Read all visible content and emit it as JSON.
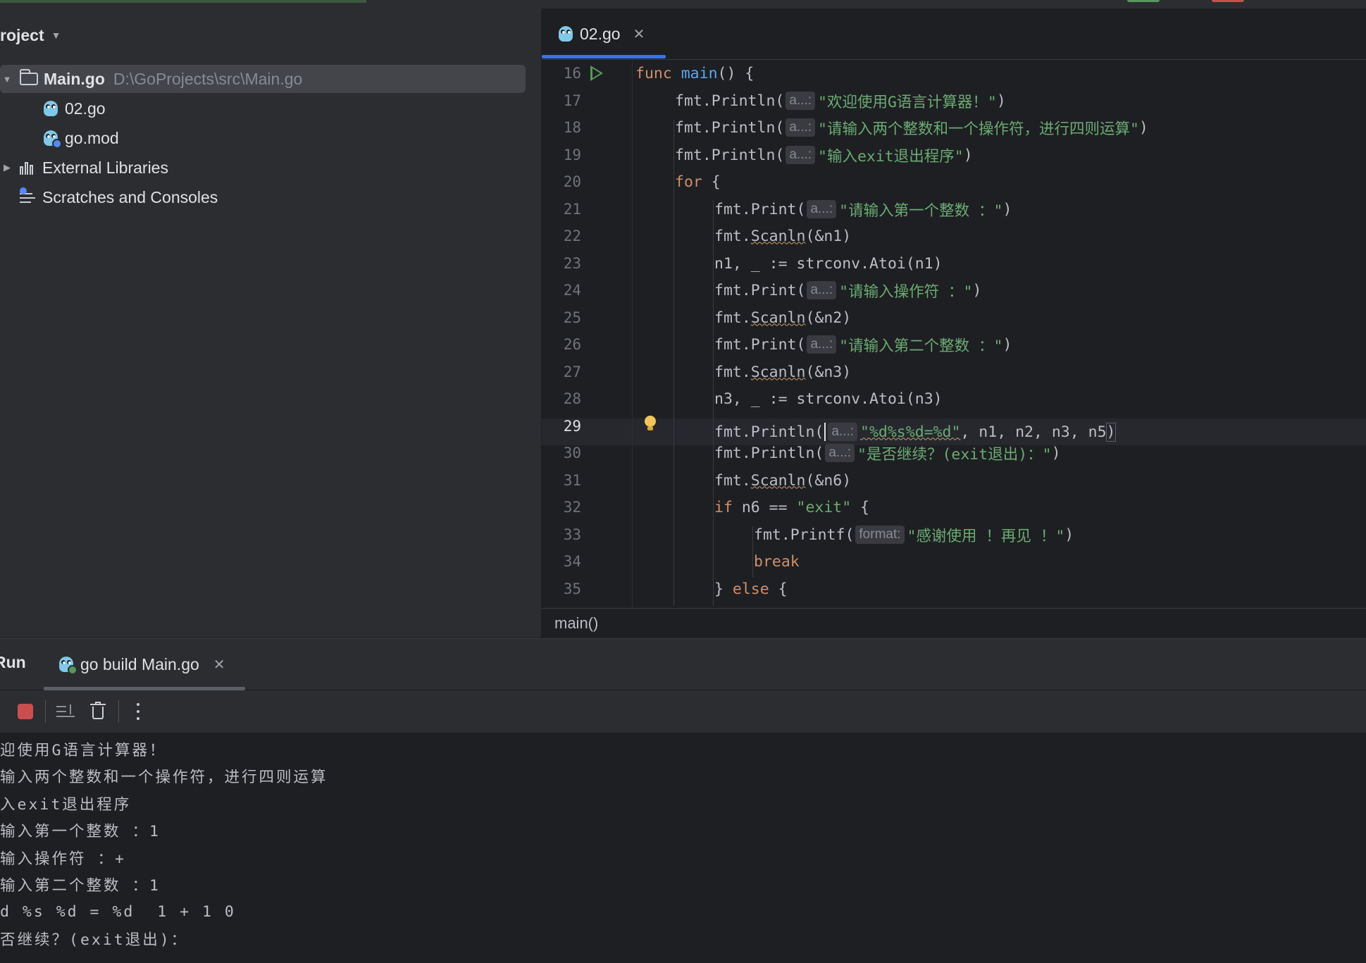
{
  "project_panel": {
    "title": "roject",
    "items": [
      {
        "label": "Main.go",
        "path": "D:\\GoProjects\\src\\Main.go"
      },
      {
        "label": "02.go"
      },
      {
        "label": "go.mod"
      },
      {
        "label": "External Libraries"
      },
      {
        "label": "Scratches and Consoles"
      }
    ]
  },
  "editor": {
    "tab_label": "02.go",
    "breadcrumb": "main()",
    "active_line": 29,
    "lines": [
      {
        "n": "16",
        "kw1": "func ",
        "fn": "main",
        "rest": "() {"
      },
      {
        "n": "17",
        "call": "fmt.Println(",
        "hint": "a...:",
        "str": "\"欢迎使用G语言计算器！\"",
        "tail": ")"
      },
      {
        "n": "18",
        "call": "fmt.Println(",
        "hint": "a...:",
        "str": "\"请输入两个整数和一个操作符，进行四则运算\"",
        "tail": ")"
      },
      {
        "n": "19",
        "call": "fmt.Println(",
        "hint": "a...:",
        "str": "\"输入exit退出程序\"",
        "tail": ")"
      },
      {
        "n": "20",
        "kw": "for",
        "rest": " {"
      },
      {
        "n": "21",
        "call": "fmt.Print(",
        "hint": "a...:",
        "str": "\"请输入第一个整数 ：\"",
        "tail": ")"
      },
      {
        "n": "22",
        "pre": "fmt.",
        "sq": "Scanln",
        "rest": "(&n1)"
      },
      {
        "n": "23",
        "var": "n1",
        "rest": ", _ := strconv.Atoi(n1)"
      },
      {
        "n": "24",
        "call": "fmt.Print(",
        "hint": "a...:",
        "str": "\"请输入操作符 ：\"",
        "tail": ")"
      },
      {
        "n": "25",
        "pre": "fmt.",
        "sq": "Scanln",
        "rest": "(&n2)"
      },
      {
        "n": "26",
        "call": "fmt.Print(",
        "hint": "a...:",
        "str": "\"请输入第二个整数 ：\"",
        "tail": ")"
      },
      {
        "n": "27",
        "pre": "fmt.",
        "sq": "Scanln",
        "rest": "(&n3)"
      },
      {
        "n": "28",
        "var": "n3",
        "rest": ", _ := strconv.Atoi(n3)"
      },
      {
        "n": "29",
        "call": "fmt.Println(",
        "hint": "a...:",
        "str": "\"%d%s%d=%d\"",
        "args": ", n1, n2, n3, n5",
        "tail": ")"
      },
      {
        "n": "30",
        "call": "fmt.Println(",
        "hint": "a...:",
        "str": "\"是否继续？(exit退出)：\"",
        "tail": ")"
      },
      {
        "n": "31",
        "pre": "fmt.",
        "sq": "Scanln",
        "rest": "(&n6)"
      },
      {
        "n": "32",
        "kw": "if",
        "rest": " n6 == ",
        "str": "\"exit\"",
        "tail": " {"
      },
      {
        "n": "33",
        "call": "fmt.Printf(",
        "hint": "format:",
        "str": "\"感谢使用 ！再见 ！\"",
        "tail": ")"
      },
      {
        "n": "34",
        "kw": "break"
      },
      {
        "n": "35",
        "rest": "} ",
        "kw": "else",
        "tail": " {"
      }
    ]
  },
  "run_panel": {
    "title": "Run",
    "tab_label": "go build Main.go",
    "console": [
      "迎使用G语言计算器！",
      "输入两个整数和一个操作符，进行四则运算",
      "入exit退出程序",
      "输入第一个整数 ：1",
      "输入操作符 ：+",
      "输入第二个整数 ：1",
      "d %s %d = %d  1 + 1 0",
      "否继续？(exit退出)："
    ]
  },
  "colors": {
    "keyword": "#cf8e6d",
    "function": "#56a8f5",
    "string": "#6aab73",
    "accent": "#3574f0",
    "stop": "#c94f4f"
  }
}
